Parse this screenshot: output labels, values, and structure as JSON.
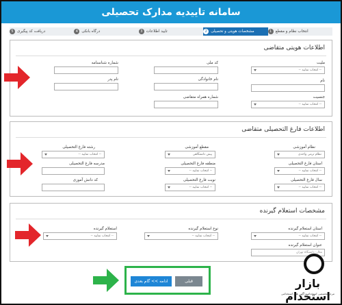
{
  "window": {
    "title": "سامانه تاییدیه مدارک تحصیلی"
  },
  "steps": [
    {
      "num": "1",
      "label": "انتخاب نظام و مقطع",
      "active": false
    },
    {
      "num": "2",
      "label": "مشخصات هویتی و تحصیلی",
      "active": true
    },
    {
      "num": "3",
      "label": "تایید اطلاعات",
      "active": false
    },
    {
      "num": "4",
      "label": "درگاه بانکی",
      "active": false
    },
    {
      "num": "5",
      "label": "دریافت کد پیگیری",
      "active": false
    }
  ],
  "identity": {
    "title": "اطلاعات هویتی متقاضی",
    "nationality_label": "ملیت",
    "nationality_value": "-- انتخاب نمایید --",
    "national_code_label": "کد ملی",
    "id_number_label": "شماره شناسنامه",
    "first_name_label": "نام",
    "last_name_label": "نام خانوادگی",
    "father_name_label": "نام پدر",
    "gender_label": "جنسیت",
    "gender_value": "-- انتخاب نمایید --",
    "phone_label": "شماره همراه متقاضی"
  },
  "education": {
    "title": "اطلاعات فارغ التحصیلی متقاضی",
    "system_label": "نظام آموزشی",
    "system_value": "نظام ترمی واحدی",
    "grade_label": "مقطع آموزشی",
    "grade_value": "پیش دانشگاهی",
    "field_label": "رشته فارغ التحصیلی",
    "field_value": "-- انتخاب نمایید --",
    "province_label": "استان فارغ التحصیلی",
    "province_value": "-- انتخاب نمایید --",
    "region_label": "منطقه فارغ التحصیلی",
    "region_value": "-- انتخاب نمایید --",
    "school_label": "مدرسه فارغ التحصیلی",
    "grad_year_label": "سال فارغ التحصیلی",
    "grad_year_value": "-- انتخاب نمایید --",
    "turn_label": "نوبت فارغ التحصیلی",
    "turn_value": "-- انتخاب نمایید --",
    "student_code_label": "کد دانش آموزی"
  },
  "employer": {
    "title": "مشخصات استعلام گیرنده",
    "province_label": "استان استعلام گیرنده",
    "province_value": "-- انتخاب نمایید --",
    "type_label": "نوع استعلام گیرنده",
    "type_value": "-- انتخاب نمایید --",
    "inquirer_label": "استعلام گیرنده",
    "inquirer_value": "-- انتخاب نمایید --",
    "name_label": "عنوان استعلام گیرنده",
    "name_placeholder": "مثال: دانشگاه تهران"
  },
  "buttons": {
    "prev": "قبلی",
    "next": "ادامه >> گام بعدی"
  },
  "watermark": {
    "brand": "بازار استخدام",
    "tagline": "مرجع تخصصی استخدام و آگهی های استخدامی"
  },
  "colors": {
    "header": "#1a98d6",
    "active_step": "#1b6fb3",
    "next_button": "#1f86d6",
    "arrow_red": "#e3262b",
    "arrow_green": "#2db34a"
  }
}
